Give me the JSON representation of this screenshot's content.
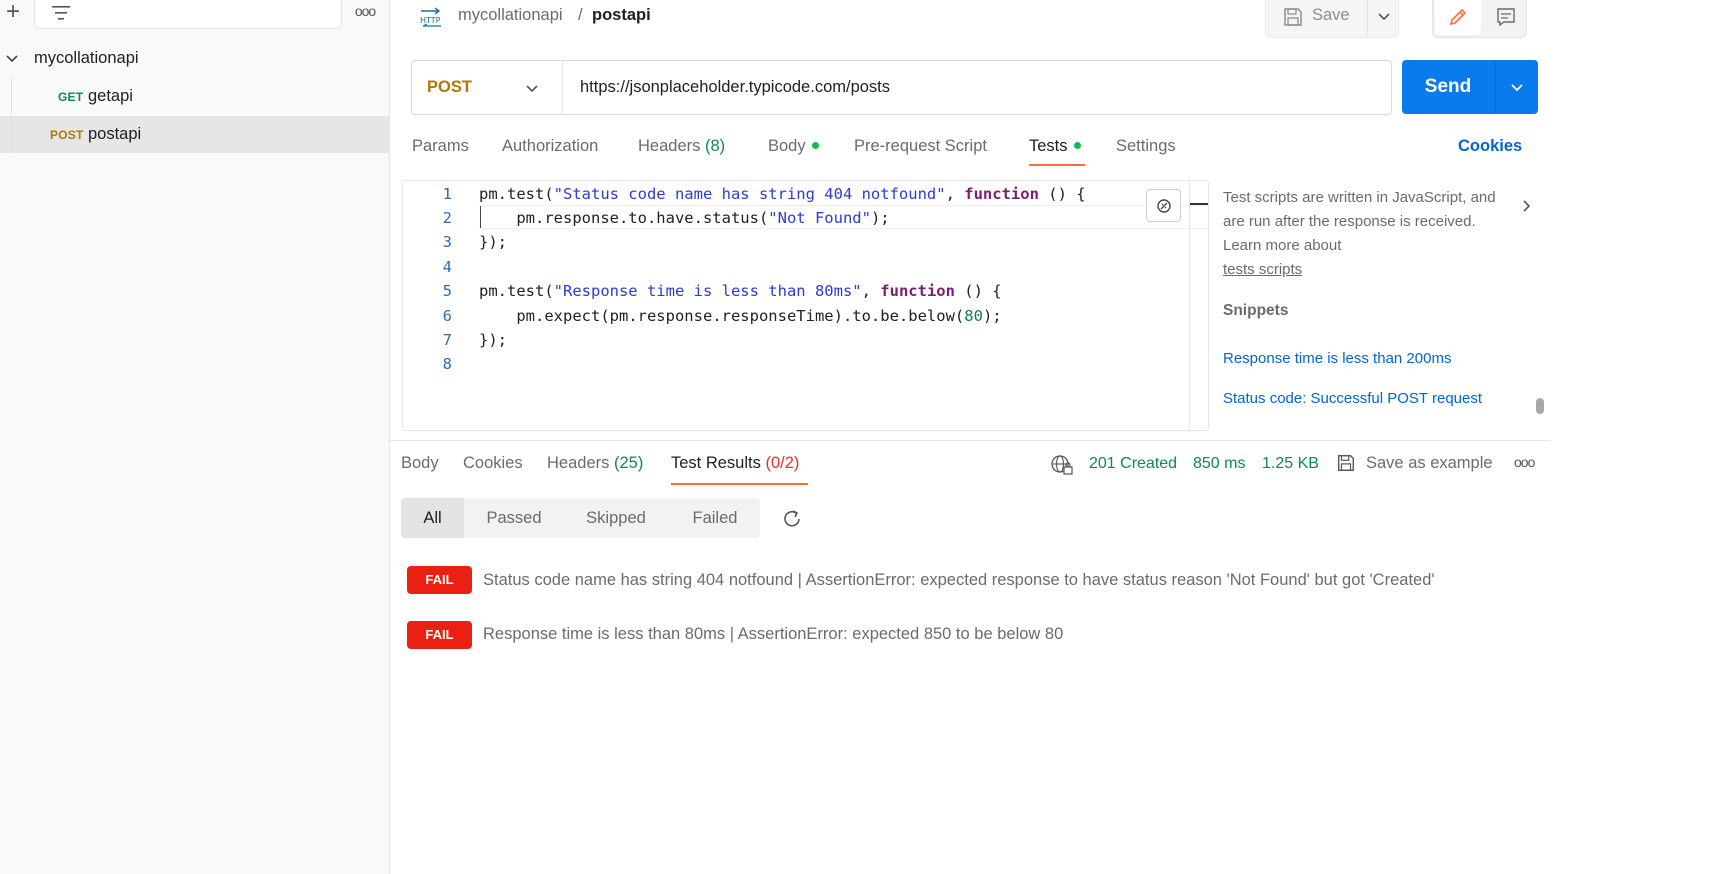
{
  "sidebar": {
    "collection_name": "mycollationapi",
    "items": [
      {
        "method": "GET",
        "name": "getapi",
        "method_color": "#0c8a4f"
      },
      {
        "method": "POST",
        "name": "postapi",
        "method_color": "#ad7a03",
        "active": true
      }
    ]
  },
  "header": {
    "collection": "mycollationapi",
    "separator": "/",
    "request": "postapi",
    "save_label": "Save"
  },
  "request": {
    "method": "POST",
    "url": "https://jsonplaceholder.typicode.com/posts",
    "send_label": "Send"
  },
  "tabs": {
    "params": "Params",
    "authorization": "Authorization",
    "headers": "Headers",
    "headers_count": "(8)",
    "body": "Body",
    "prerequest": "Pre-request Script",
    "tests": "Tests",
    "settings": "Settings",
    "cookies": "Cookies"
  },
  "editor": {
    "line_numbers": [
      "1",
      "2",
      "3",
      "4",
      "5",
      "6",
      "7",
      "8"
    ],
    "l1_a": "pm.test(",
    "l1_str": "\"Status code name has string 404 notfound\"",
    "l1_b": ", ",
    "l1_kw": "function",
    "l1_c": " () {",
    "l2_a": "    pm.response.to.have.status(",
    "l2_str": "\"Not Found\"",
    "l2_b": ");",
    "l3": "});",
    "l5_a": "pm.test(",
    "l5_str": "\"Response time is less than 80ms\"",
    "l5_b": ", ",
    "l5_kw": "function",
    "l5_c": " () {",
    "l6_a": "    pm.expect(pm.response.responseTime).to.be.below(",
    "l6_num": "80",
    "l6_b": ");",
    "l7": "});"
  },
  "side_panel": {
    "help_text": "Test scripts are written in JavaScript, and are run after the response is received. Learn more about",
    "help_link": "tests scripts",
    "snippets_title": "Snippets",
    "snippets": [
      "Response time is less than 200ms",
      "Status code: Successful POST request"
    ]
  },
  "response": {
    "tabs": {
      "body": "Body",
      "cookies": "Cookies",
      "headers": "Headers",
      "headers_count": "(25)",
      "test_results": "Test Results",
      "test_results_count": "(0/2)"
    },
    "status": "201 Created",
    "time": "850 ms",
    "size": "1.25 KB",
    "save_example": "Save as example",
    "filters": [
      "All",
      "Passed",
      "Skipped",
      "Failed"
    ],
    "results": [
      {
        "status": "FAIL",
        "text": "Status code name has string 404 notfound | AssertionError: expected response to have status reason 'Not Found' but got 'Created'"
      },
      {
        "status": "FAIL",
        "text": "Response time is less than 80ms | AssertionError: expected 850 to be below 80"
      }
    ]
  },
  "colors": {
    "accent": "#ff6c37",
    "send": "#097bed",
    "fail": "#eb2013",
    "success": "#0c8a4f"
  }
}
